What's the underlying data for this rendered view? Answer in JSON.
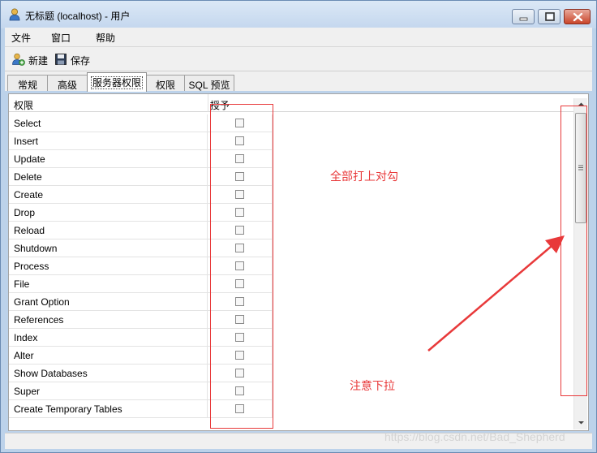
{
  "window": {
    "title": "无标题 (localhost) - 用户"
  },
  "menu": {
    "items": [
      "文件",
      "窗口",
      "帮助"
    ]
  },
  "toolbar": {
    "new_label": "新建",
    "save_label": "保存"
  },
  "tabs": [
    {
      "label": "常规",
      "active": false
    },
    {
      "label": "高级",
      "active": false
    },
    {
      "label": "服务器权限",
      "active": true
    },
    {
      "label": "权限",
      "active": false
    },
    {
      "label": "SQL 预览",
      "active": false
    }
  ],
  "grid": {
    "headers": {
      "privilege": "权限",
      "grant": "授予"
    },
    "rows": [
      {
        "name": "Select",
        "granted": false
      },
      {
        "name": "Insert",
        "granted": false
      },
      {
        "name": "Update",
        "granted": false
      },
      {
        "name": "Delete",
        "granted": false
      },
      {
        "name": "Create",
        "granted": false
      },
      {
        "name": "Drop",
        "granted": false
      },
      {
        "name": "Reload",
        "granted": false
      },
      {
        "name": "Shutdown",
        "granted": false
      },
      {
        "name": "Process",
        "granted": false
      },
      {
        "name": "File",
        "granted": false
      },
      {
        "name": "Grant Option",
        "granted": false
      },
      {
        "name": "References",
        "granted": false
      },
      {
        "name": "Index",
        "granted": false
      },
      {
        "name": "Alter",
        "granted": false
      },
      {
        "name": "Show Databases",
        "granted": false
      },
      {
        "name": "Super",
        "granted": false
      },
      {
        "name": "Create Temporary Tables",
        "granted": false
      }
    ]
  },
  "annotations": {
    "check_all": "全部打上对勾",
    "scroll_down": "注意下拉",
    "color": "#e8393a"
  },
  "watermark": "https://blog.csdn.net/Bad_Shepherd",
  "icons": {
    "title": "user-icon",
    "new": "add-user-icon",
    "save": "save-icon"
  }
}
